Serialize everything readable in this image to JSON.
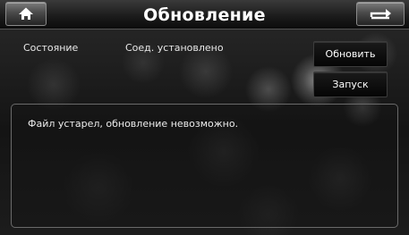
{
  "header": {
    "title": "Обновление",
    "home_icon": "home-icon",
    "back_icon": "back-arrow-icon"
  },
  "status": {
    "label": "Состояние",
    "value": "Соед. установлено"
  },
  "actions": {
    "update_label": "Обновить",
    "run_label": "Запуск"
  },
  "message": {
    "text": "Файл устарел, обновление невозможно."
  }
}
